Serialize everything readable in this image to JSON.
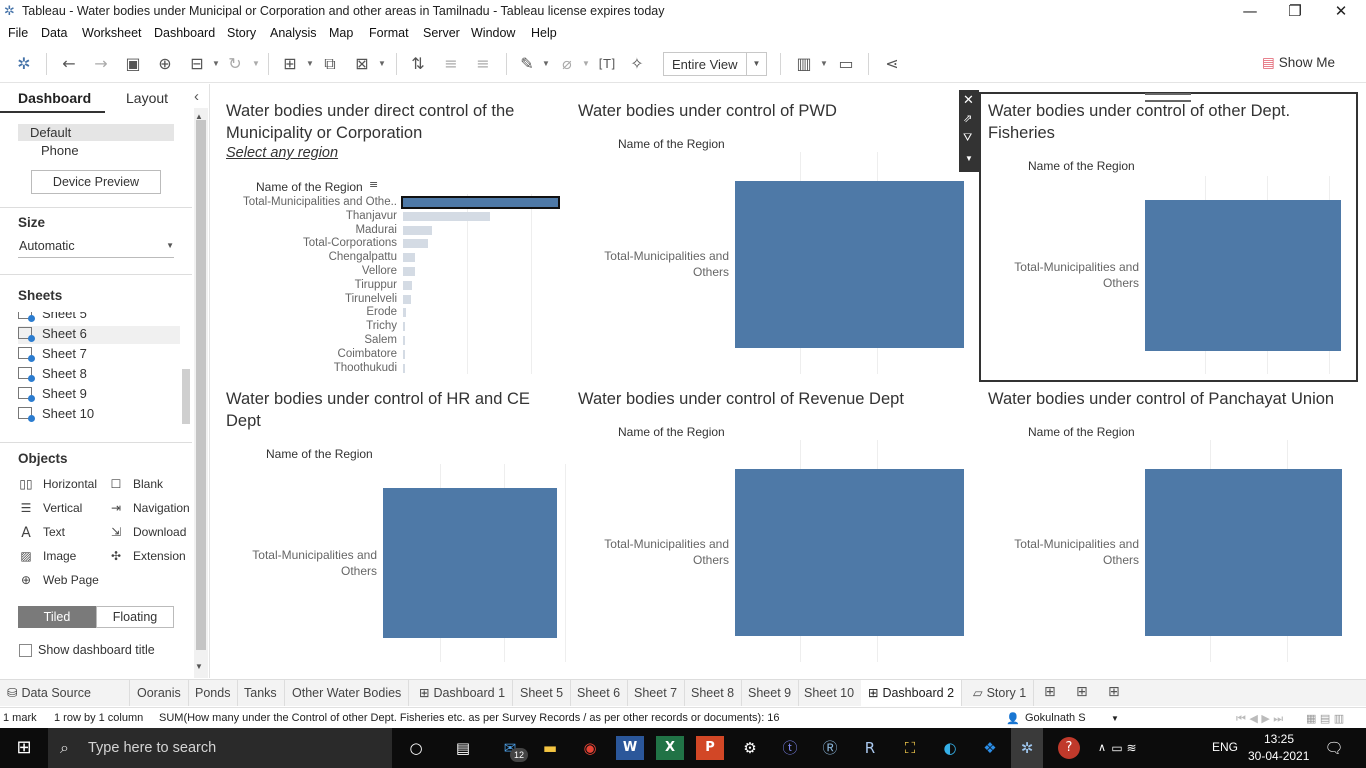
{
  "window": {
    "title": "Tableau - Water bodies under Municipal or Corporation and other areas in Tamilnadu - Tableau license expires today",
    "minimize": "—",
    "restore": "❐",
    "close": "✕"
  },
  "menu": [
    "File",
    "Data",
    "Worksheet",
    "Dashboard",
    "Story",
    "Analysis",
    "Map",
    "Format",
    "Server",
    "Window",
    "Help"
  ],
  "toolbar": {
    "fit_selected": "Entire View",
    "show_me": "Show Me"
  },
  "sidebar": {
    "tab_dashboard": "Dashboard",
    "tab_layout": "Layout",
    "collapse": "‹",
    "device_default": "Default",
    "device_phone": "Phone",
    "device_preview_button": "Device Preview",
    "size_title": "Size",
    "size_value": "Automatic",
    "sheets_title": "Sheets",
    "sheets": [
      "Sheet 5",
      "Sheet 6",
      "Sheet 7",
      "Sheet 8",
      "Sheet 9",
      "Sheet 10"
    ],
    "objects_title": "Objects",
    "objects": {
      "horizontal": "Horizontal",
      "blank": "Blank",
      "vertical": "Vertical",
      "navigation": "Navigation",
      "text": "Text",
      "download": "Download",
      "image": "Image",
      "extension": "Extension",
      "web_page": "Web Page"
    },
    "tiled": "Tiled",
    "floating": "Floating",
    "show_title": "Show dashboard title"
  },
  "dashboard": {
    "panel1": {
      "title": "Water bodies under direct control of the Municipality or Corporation",
      "subtitle": "Select any region",
      "axis_header": "Name of the Region",
      "categories": [
        "Total-Municipalities and Othe..",
        "Thanjavur",
        "Madurai",
        "Total-Corporations",
        "Chengalpattu",
        "Vellore",
        "Tiruppur",
        "Tirunelveli",
        "Erode",
        "Trichy",
        "Salem",
        "Coimbatore",
        "Thoothukudi"
      ],
      "relative_values": [
        1.0,
        0.56,
        0.19,
        0.16,
        0.08,
        0.08,
        0.06,
        0.05,
        0.02,
        0.015,
        0.015,
        0.012,
        0.01
      ]
    },
    "panel2": {
      "title": "Water bodies under control of PWD",
      "axis_header": "Name of the Region",
      "category": "Total-Municipalities and Others"
    },
    "panel3": {
      "title": "Water bodies under control of other Dept. Fisheries",
      "axis_header": "Name of the Region",
      "category": "Total-Municipalities and Others"
    },
    "panel4": {
      "title": "Water bodies under control of HR and CE Dept",
      "axis_header": "Name of the Region",
      "category": "Total-Municipalities and Others"
    },
    "panel5": {
      "title": "Water bodies under control of Revenue Dept",
      "axis_header": "Name of the Region",
      "category": "Total-Municipalities and Others"
    },
    "panel6": {
      "title": "Water bodies under control of Panchayat Union",
      "axis_header": "Name of the Region",
      "category": "Total-Municipalities and Others"
    }
  },
  "sheet_tabs": [
    "Data Source",
    "Ooranis",
    "Ponds",
    "Tanks",
    "Other Water Bodies",
    "Dashboard 1",
    "Sheet 5",
    "Sheet 6",
    "Sheet 7",
    "Sheet 8",
    "Sheet 9",
    "Sheet 10",
    "Dashboard 2",
    "Story 1"
  ],
  "status": {
    "marks": "1 mark",
    "rows_cols": "1 row by 1 column",
    "summary": "SUM(How many under the Control of other Dept. Fisheries etc. as per Survey Records / as per other records or documents): 16",
    "user": "Gokulnath S"
  },
  "taskbar": {
    "search_placeholder": "Type here to search",
    "mail_badge": "12",
    "language": "ENG",
    "time": "13:25",
    "date": "30-04-2021"
  },
  "colors": {
    "bar": "#4e79a7",
    "bar_light": "#d4dbe4"
  }
}
